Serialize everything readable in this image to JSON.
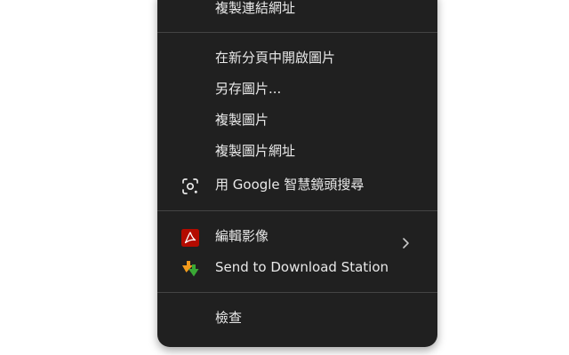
{
  "menu": {
    "items": [
      {
        "label": "複製連結網址",
        "icon": null
      },
      {
        "label": "在新分頁中開啟圖片",
        "icon": null
      },
      {
        "label": "另存圖片...",
        "icon": null
      },
      {
        "label": "複製圖片",
        "icon": null
      },
      {
        "label": "複製圖片網址",
        "icon": null
      },
      {
        "label": "用 Google 智慧鏡頭搜尋",
        "icon": "google-lens-icon"
      },
      {
        "label": "編輯影像",
        "icon": "acrobat-icon",
        "has_submenu": true
      },
      {
        "label": "Send to Download Station",
        "icon": "download-station-icon"
      },
      {
        "label": "檢查",
        "icon": null
      }
    ]
  },
  "colors": {
    "menu_background": "#202020",
    "menu_text": "#e8e8e8",
    "separator": "#444444",
    "acrobat_red": "#b30b00",
    "download_green": "#3aa935",
    "download_orange": "#f29a1d"
  }
}
